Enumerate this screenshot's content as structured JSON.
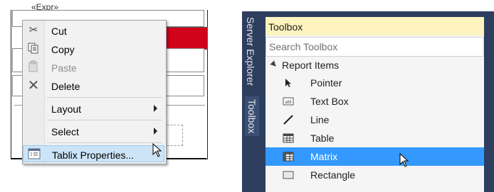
{
  "designer": {
    "expression_text": "«Expr»"
  },
  "context_menu": {
    "items": [
      {
        "label": "Cut",
        "icon": "scissors-icon",
        "enabled": true
      },
      {
        "label": "Copy",
        "icon": "copy-icon",
        "enabled": true
      },
      {
        "label": "Paste",
        "icon": "paste-icon",
        "enabled": false
      },
      {
        "label": "Delete",
        "icon": "delete-icon",
        "enabled": true
      },
      {
        "label": "Layout",
        "submenu": true
      },
      {
        "label": "Select",
        "submenu": true
      },
      {
        "label": "Tablix Properties...",
        "icon": "properties-icon",
        "highlighted": true
      }
    ]
  },
  "side_strip": {
    "tabs": [
      "Server Explorer",
      "Toolbox"
    ]
  },
  "toolbox": {
    "title": "Toolbox",
    "search_placeholder": "Search Toolbox",
    "category": "Report Items",
    "items": [
      {
        "label": "Pointer",
        "icon": "pointer-icon"
      },
      {
        "label": "Text Box",
        "icon": "textbox-icon"
      },
      {
        "label": "Line",
        "icon": "line-icon"
      },
      {
        "label": "Table",
        "icon": "table-icon"
      },
      {
        "label": "Matrix",
        "icon": "matrix-icon",
        "selected": true
      },
      {
        "label": "Rectangle",
        "icon": "rectangle-icon"
      }
    ],
    "colors": {
      "title_bg": "#fdf4bf",
      "selected_bg": "#3399ff",
      "strip_bg": "#2d3e5f"
    }
  }
}
